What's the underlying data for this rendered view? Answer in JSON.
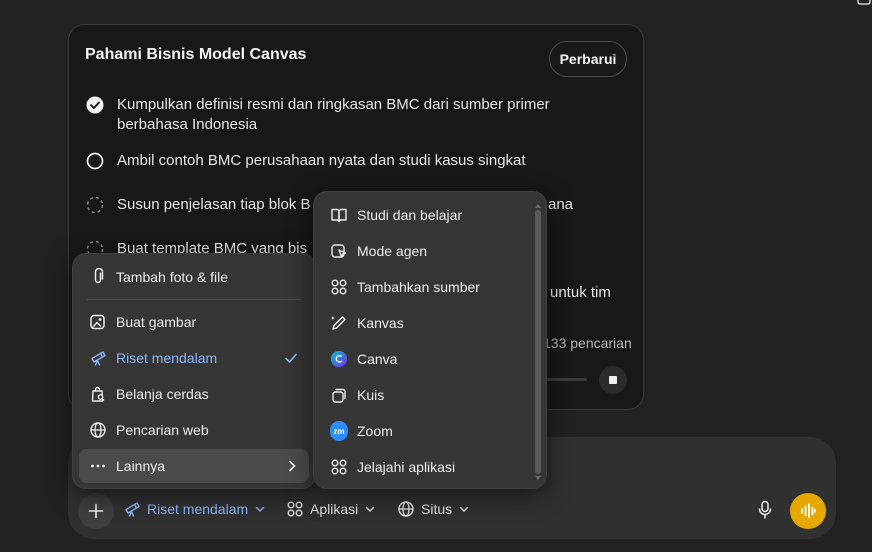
{
  "card": {
    "title": "Pahami Bisnis Model Canvas",
    "update_label": "Perbarui",
    "steps": [
      {
        "text": "Kumpulkan definisi resmi dan ringkasan BMC dari sumber primer berbahasa Indonesia",
        "state": "done"
      },
      {
        "text": "Ambil contoh BMC perusahaan nyata dan studi kasus singkat",
        "state": "active"
      },
      {
        "text": "Susun penjelasan tiap blok B",
        "tail": "ana",
        "state": "pending"
      },
      {
        "text": "Buat template BMC yang bis",
        "state": "pending"
      },
      {
        "text": "",
        "tail": "untuk tim",
        "state": "hidden"
      }
    ],
    "search_count": "133 pencarian"
  },
  "menu_left": {
    "items": [
      {
        "label": "Tambah foto & file",
        "icon": "paperclip-icon"
      },
      {
        "label": "Buat gambar",
        "icon": "image-icon"
      },
      {
        "label": "Riset mendalam",
        "icon": "telescope-icon",
        "selected": true
      },
      {
        "label": "Belanja cerdas",
        "icon": "shopping-bag-icon"
      },
      {
        "label": "Pencarian web",
        "icon": "globe-icon"
      },
      {
        "label": "Lainnya",
        "icon": "more-icon",
        "hover": true
      }
    ]
  },
  "menu_right": {
    "items": [
      {
        "label": "Studi dan belajar",
        "icon": "book-icon"
      },
      {
        "label": "Mode agen",
        "icon": "agent-icon"
      },
      {
        "label": "Tambahkan sumber",
        "icon": "apps-grid-icon"
      },
      {
        "label": "Kanvas",
        "icon": "pen-icon"
      },
      {
        "label": "Canva",
        "icon": "canva-logo-icon"
      },
      {
        "label": "Kuis",
        "icon": "quiz-icon"
      },
      {
        "label": "Zoom",
        "icon": "zoom-logo-icon",
        "logo_text": "zm"
      },
      {
        "label": "Jelajahi aplikasi",
        "icon": "apps-grid-icon"
      }
    ]
  },
  "composer": {
    "tools": [
      {
        "label": "Riset mendalam",
        "icon": "telescope-icon",
        "active": true
      },
      {
        "label": "Aplikasi",
        "icon": "apps-grid-icon"
      },
      {
        "label": "Situs",
        "icon": "globe-icon"
      }
    ]
  },
  "colors": {
    "accent_blue": "#8ab4f8",
    "voice_button": "#e5a800",
    "canva": "#7d2ae8",
    "zoom": "#2d8cff"
  }
}
